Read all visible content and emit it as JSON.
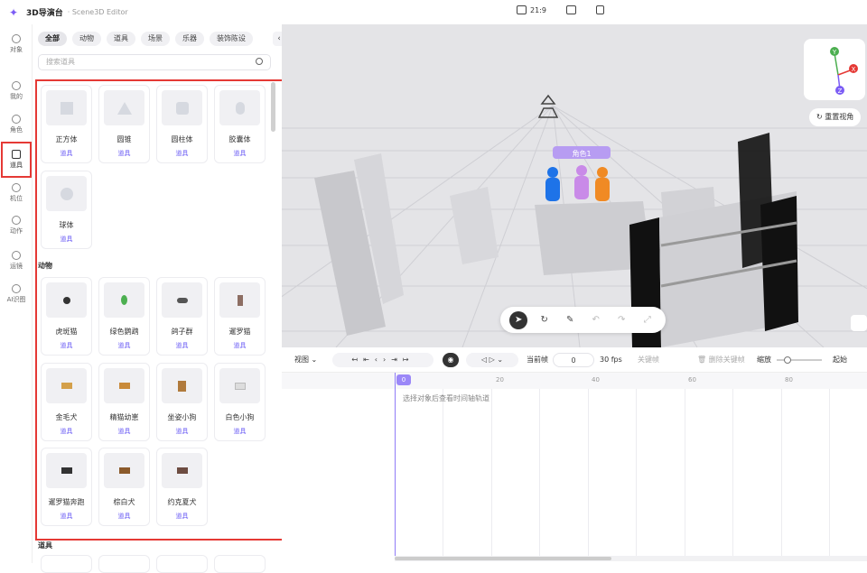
{
  "app": {
    "name": "3D导演台",
    "subtitle": "· Scene3D Editor"
  },
  "topbar": {
    "aspect_ratio": "21:9",
    "aspect_icon": "aspect-ratio-icon",
    "camera_icon": "camera-icon",
    "export_icon": "export-icon"
  },
  "leftnav": {
    "items": [
      {
        "label": "对象",
        "icon": "object-icon"
      },
      {
        "label": "我的",
        "icon": "my-icon"
      },
      {
        "label": "角色",
        "icon": "character-icon"
      },
      {
        "label": "道具",
        "icon": "prop-icon",
        "active": true
      },
      {
        "label": "机位",
        "icon": "camera-position-icon"
      },
      {
        "label": "动作",
        "icon": "action-icon"
      },
      {
        "label": "运镜",
        "icon": "camera-move-icon"
      },
      {
        "label": "AI识图",
        "icon": "ai-recognize-icon"
      }
    ]
  },
  "panel": {
    "chips": [
      "全部",
      "动物",
      "道具",
      "场景",
      "乐器",
      "装饰陈设"
    ],
    "active_chip": "全部",
    "search_placeholder": "搜索道具",
    "collapse_icon": "chevron-left-icon",
    "sections": [
      {
        "title": "",
        "items": [
          {
            "name": "正方体",
            "tag": "道具"
          },
          {
            "name": "圆锥",
            "tag": "道具"
          },
          {
            "name": "圆柱体",
            "tag": "道具"
          },
          {
            "name": "胶囊体",
            "tag": "道具"
          },
          {
            "name": "球体",
            "tag": "道具"
          }
        ]
      },
      {
        "title": "动物",
        "items": [
          {
            "name": "虎斑猫",
            "tag": "道具"
          },
          {
            "name": "绿色鹦鹉",
            "tag": "道具"
          },
          {
            "name": "鸽子群",
            "tag": "道具"
          },
          {
            "name": "暹罗猫",
            "tag": "道具"
          },
          {
            "name": "金毛犬",
            "tag": "道具"
          },
          {
            "name": "精猫幼崽",
            "tag": "道具"
          },
          {
            "name": "坐姿小狗",
            "tag": "道具"
          },
          {
            "name": "白色小狗",
            "tag": "道具"
          },
          {
            "name": "暹罗猫奔跑",
            "tag": "道具"
          },
          {
            "name": "棕白犬",
            "tag": "道具"
          },
          {
            "name": "约克夏犬",
            "tag": "道具"
          }
        ]
      },
      {
        "title": "道具",
        "items": []
      }
    ]
  },
  "viewport": {
    "reset_view": "重置视角",
    "character_label": "角色1",
    "tools": [
      {
        "icon": "select-cursor-icon",
        "active": true
      },
      {
        "icon": "rotate-icon"
      },
      {
        "icon": "edit-icon"
      },
      {
        "icon": "undo-icon"
      },
      {
        "icon": "redo-icon"
      },
      {
        "icon": "scale-icon"
      }
    ],
    "axes": [
      "Y",
      "X",
      "Z"
    ]
  },
  "timeline": {
    "view_label": "视图",
    "current_frame_label": "当前帧",
    "current_frame_value": "0",
    "fps": "30 fps",
    "disabled_label": "关键帧",
    "delete_keyframe": "删除关键帧",
    "zoom_label": "缩放",
    "start_label": "起始",
    "ruler_marks": [
      "0",
      "20",
      "40",
      "60",
      "80"
    ],
    "hint": "选择对象后查看时间轴轨道"
  },
  "colors": {
    "accent": "#7b5cf5",
    "highlight": "#e53935"
  }
}
